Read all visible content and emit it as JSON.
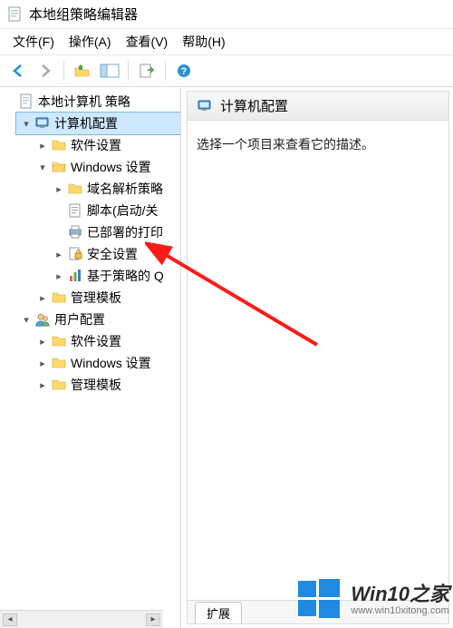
{
  "window": {
    "title": "本地组策略编辑器"
  },
  "menu": {
    "file": "文件(F)",
    "action": "操作(A)",
    "view": "查看(V)",
    "help": "帮助(H)"
  },
  "tree": {
    "root": "本地计算机 策略",
    "computer": "计算机配置",
    "comp_soft": "软件设置",
    "comp_win": "Windows 设置",
    "dns": "域名解析策略",
    "scripts": "脚本(启动/关",
    "printers": "已部署的打印",
    "security": "安全设置",
    "policy": "基于策略的 Q",
    "comp_admin": "管理模板",
    "user": "用户配置",
    "user_soft": "软件设置",
    "user_win": "Windows 设置",
    "user_admin": "管理模板"
  },
  "detail": {
    "title": "计算机配置",
    "message": "选择一个项目来查看它的描述。",
    "tab": "扩展"
  },
  "watermark": {
    "main": "Win10之家",
    "sub": "www.win10xitong.com"
  }
}
